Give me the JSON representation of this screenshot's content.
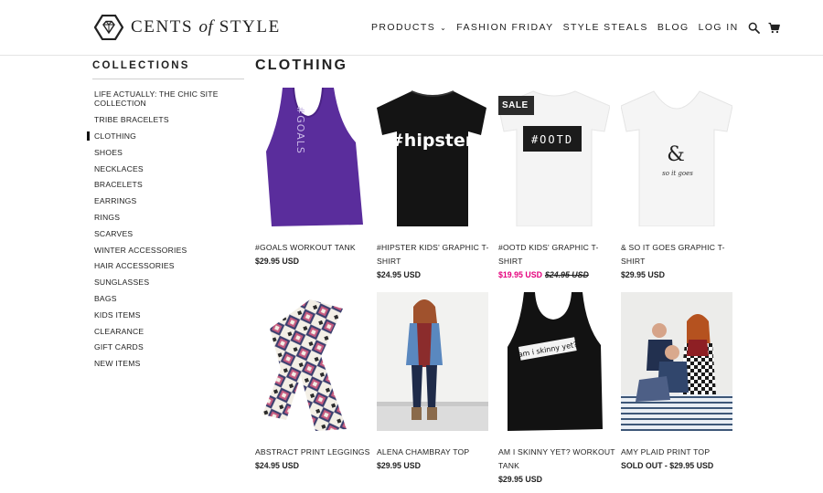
{
  "header": {
    "logo_primary": "CENTS",
    "logo_of": "of",
    "logo_secondary": "STYLE",
    "nav": [
      {
        "label": "PRODUCTS",
        "has_dropdown": true
      },
      {
        "label": "FASHION FRIDAY"
      },
      {
        "label": "STYLE STEALS"
      },
      {
        "label": "BLOG"
      },
      {
        "label": "LOG IN"
      }
    ],
    "icons": [
      "search-icon",
      "cart-icon"
    ]
  },
  "sidebar": {
    "title": "COLLECTIONS",
    "items": [
      {
        "label": "LIFE ACTUALLY: THE CHIC SITE COLLECTION"
      },
      {
        "label": "TRIBE BRACELETS"
      },
      {
        "label": "CLOTHING",
        "active": true
      },
      {
        "label": "SHOES"
      },
      {
        "label": "NECKLACES"
      },
      {
        "label": "BRACELETS"
      },
      {
        "label": "EARRINGS"
      },
      {
        "label": "RINGS"
      },
      {
        "label": "SCARVES"
      },
      {
        "label": "WINTER ACCESSORIES"
      },
      {
        "label": "HAIR ACCESSORIES"
      },
      {
        "label": "SUNGLASSES"
      },
      {
        "label": "BAGS"
      },
      {
        "label": "KIDS ITEMS"
      },
      {
        "label": "CLEARANCE"
      },
      {
        "label": "GIFT CARDS"
      },
      {
        "label": "NEW ITEMS"
      }
    ]
  },
  "main": {
    "title": "CLOTHING",
    "products": [
      {
        "name": "#GOALS WORKOUT TANK",
        "price": "$29.95 USD",
        "image_text": "#GOALS"
      },
      {
        "name": "#HIPSTER KIDS' GRAPHIC T-SHIRT",
        "price": "$24.95 USD",
        "image_text": "#hipster"
      },
      {
        "name": "#OOTD KIDS' GRAPHIC T-SHIRT",
        "sale_price": "$19.95 USD",
        "was_price": "$24.95 USD",
        "badge": "SALE",
        "image_text": "#OOTD"
      },
      {
        "name": "& SO IT GOES GRAPHIC T-SHIRT",
        "price": "$29.95 USD",
        "image_text": "&",
        "image_subtext": "so it goes"
      },
      {
        "name": "ABSTRACT PRINT LEGGINGS",
        "price": "$24.95 USD"
      },
      {
        "name": "ALENA CHAMBRAY TOP",
        "price": "$29.95 USD"
      },
      {
        "name": "AM I SKINNY YET? WORKOUT TANK",
        "price": "$29.95 USD",
        "image_text": "am i skinny yet?"
      },
      {
        "name": "AMY PLAID PRINT TOP",
        "price": "SOLD OUT - $29.95 USD"
      }
    ]
  },
  "colors": {
    "sale_price": "#e5007d",
    "text": "#222222",
    "badge_bg": "#2b2b2b"
  }
}
